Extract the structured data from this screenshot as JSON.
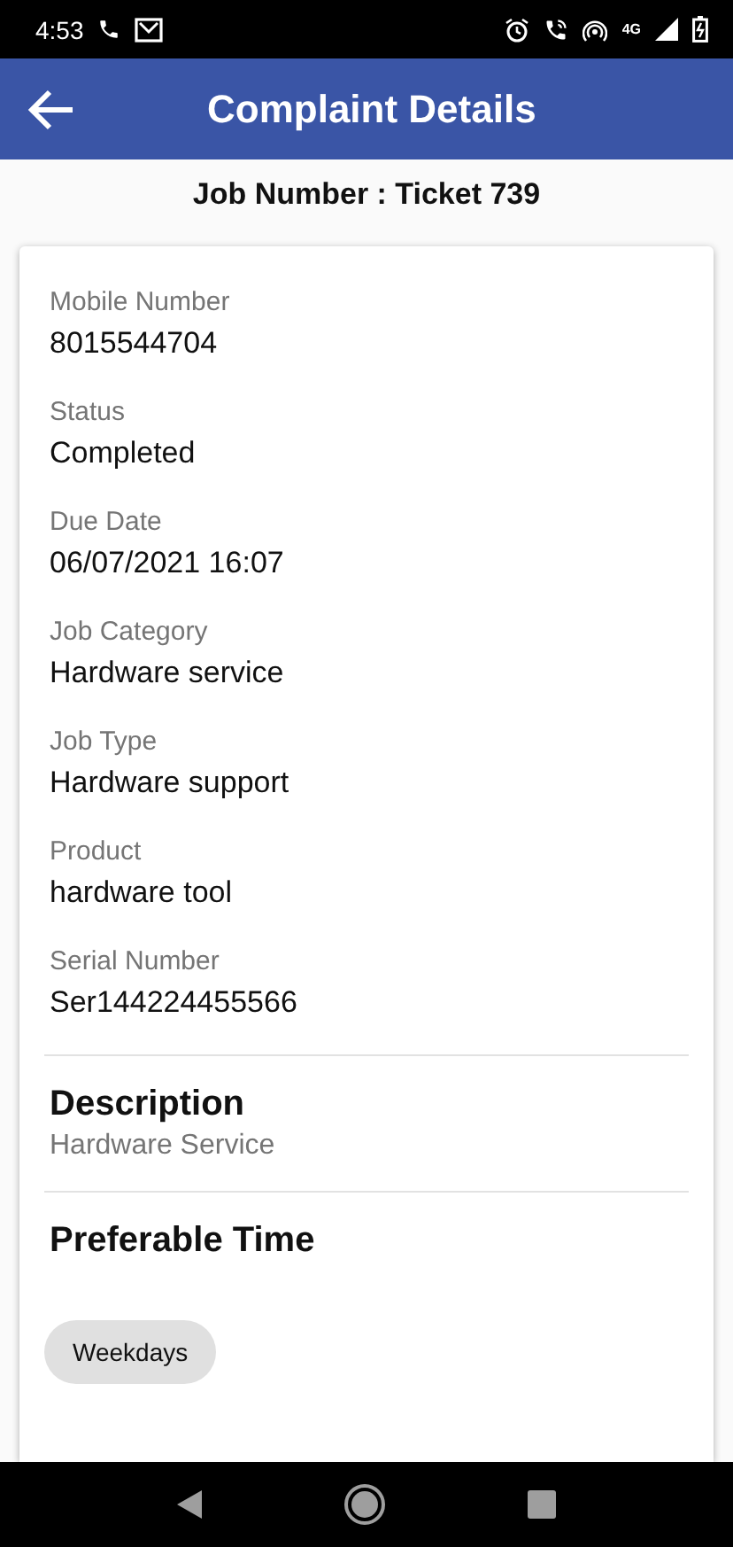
{
  "status_bar": {
    "time": "4:53",
    "network": "4G"
  },
  "app_bar": {
    "title": "Complaint Details"
  },
  "job_number": "Job Number : Ticket 739",
  "fields": [
    {
      "label": "Mobile Number",
      "value": "8015544704"
    },
    {
      "label": "Status",
      "value": "Completed"
    },
    {
      "label": "Due Date",
      "value": "06/07/2021 16:07"
    },
    {
      "label": "Job Category",
      "value": "Hardware service"
    },
    {
      "label": "Job Type",
      "value": "Hardware support"
    },
    {
      "label": "Product",
      "value": "hardware tool"
    },
    {
      "label": "Serial Number",
      "value": "Ser144224455566"
    }
  ],
  "description": {
    "heading": "Description",
    "text": "Hardware Service"
  },
  "preferable_time": {
    "heading": "Preferable Time",
    "chips": [
      {
        "label": "Weekdays"
      }
    ]
  }
}
